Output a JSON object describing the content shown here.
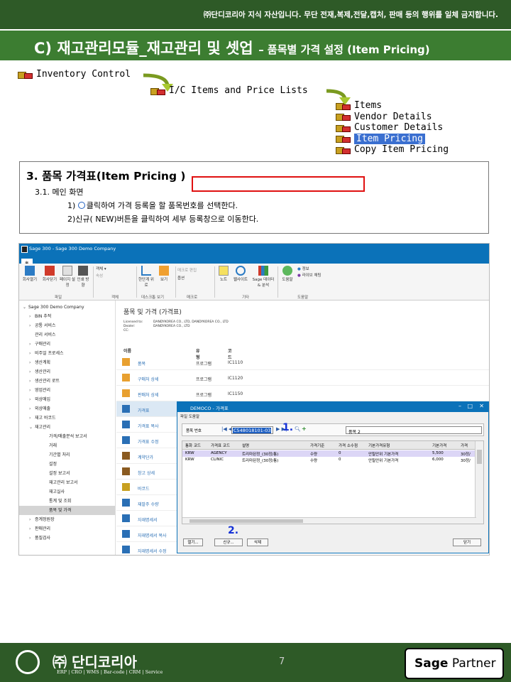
{
  "header": {
    "notice": "㈜단디코리아 지식 자산입니다. 무단 전재,복제,전달,캡처, 판매 등의 행위를 일체 금지합니다.",
    "title": "C) 재고관리모듈_재고관리 및 셋업",
    "subtitle": "– 품목별 가격 설정 (Item Pricing)"
  },
  "tree": {
    "root": "Inventory Control",
    "folder": "I/C Items and Price Lists",
    "items": [
      "Items",
      "Vendor Details",
      "Customer Details",
      "Item Pricing",
      "Copy Item Pricing"
    ],
    "selected": "Item Pricing"
  },
  "instructions": {
    "heading": "3. 품목 가격표(Item Pricing )",
    "sub": "3.1. 메인 화면",
    "step1": "클릭하여 가격 등록을 할 품목번호를 선택한다.",
    "step1_prefix": "1)",
    "step2": "2)신규( NEW)버튼을 클릭하여 세부 등록창으로 이동한다."
  },
  "sage": {
    "window_title": "Sage 300 - Sage 300 Demo Company",
    "menu_tab": "홈",
    "ribbon": {
      "buttons": [
        "회사열기",
        "회사닫기",
        "페이지 설정",
        "인쇄 방향",
        "객체",
        "속성",
        "한단계 위로",
        "보기",
        "매크로 편집",
        "옵션",
        "노트",
        "웹사이트",
        "Sage 데이터 & 분석",
        "도움말",
        "정보",
        "라이브 채팅"
      ],
      "groups": [
        "파일",
        "객체",
        "데스크톱 보기",
        "매크로",
        "기타",
        "도움말"
      ]
    },
    "nav": [
      {
        "label": "Sage 300 Demo Company",
        "level": 0,
        "chev": "⌄"
      },
      {
        "label": "BIN 추적",
        "level": 1,
        "chev": "›"
      },
      {
        "label": "공통 서비스",
        "level": 1,
        "chev": "›"
      },
      {
        "label": "관리 서비스",
        "level": 1,
        "chev": ""
      },
      {
        "label": "구매관리",
        "level": 1,
        "chev": "›"
      },
      {
        "label": "비주얼 프로세스",
        "level": 1,
        "chev": "›"
      },
      {
        "label": "생산계획",
        "level": 1,
        "chev": "›"
      },
      {
        "label": "생산관리",
        "level": 1,
        "chev": "›"
      },
      {
        "label": "생산관리 로트",
        "level": 1,
        "chev": "›"
      },
      {
        "label": "영업관리",
        "level": 1,
        "chev": "›"
      },
      {
        "label": "외상매입",
        "level": 1,
        "chev": "›"
      },
      {
        "label": "외상매출",
        "level": 1,
        "chev": "›"
      },
      {
        "label": "재고 바코드",
        "level": 1,
        "chev": "›"
      },
      {
        "label": "재고관리",
        "level": 1,
        "chev": "⌄"
      },
      {
        "label": "가격/매출분석 보고서",
        "level": 2,
        "chev": ""
      },
      {
        "label": "거래",
        "level": 2,
        "chev": ""
      },
      {
        "label": "기간별 처리",
        "level": 2,
        "chev": ""
      },
      {
        "label": "설정",
        "level": 2,
        "chev": ""
      },
      {
        "label": "설정 보고서",
        "level": 2,
        "chev": ""
      },
      {
        "label": "재고관리 보고서",
        "level": 2,
        "chev": ""
      },
      {
        "label": "재고실사",
        "level": 2,
        "chev": ""
      },
      {
        "label": "통계 및 조회",
        "level": 2,
        "chev": ""
      },
      {
        "label": "품목 및 가격",
        "level": 2,
        "chev": "",
        "selected": true
      },
      {
        "label": "증계정원장",
        "level": 1,
        "chev": "›"
      },
      {
        "label": "판매관리",
        "level": 1,
        "chev": "›"
      },
      {
        "label": "품질검사",
        "level": 1,
        "chev": "›"
      }
    ],
    "content_title": "품목 및 가격 (가격표)",
    "license": {
      "licensed_label": "Licensed to:",
      "licensed_value": "DANDYKOREA CO., LTD, DANDYKOREA CO., LTD",
      "dealer_label": "Dealer:",
      "dealer_value": "DANDYKOREA CO., LTD",
      "cc_label": "CC:"
    },
    "columns": {
      "name": "이름",
      "type": "유형",
      "code": "코드"
    },
    "programs": [
      {
        "name": "품목",
        "type": "프로그램",
        "code": "IC1110"
      },
      {
        "name": "구매처 상세",
        "type": "프로그램",
        "code": "IC1120"
      },
      {
        "name": "판매처 상세",
        "type": "프로그램",
        "code": "IC1150"
      },
      {
        "name": "가격표",
        "type": "",
        "code": "",
        "selected": true
      },
      {
        "name": "가격표 복사",
        "type": "",
        "code": ""
      },
      {
        "name": "가격표 수정",
        "type": "",
        "code": ""
      },
      {
        "name": "계약단가",
        "type": "",
        "code": ""
      },
      {
        "name": "창고 상세",
        "type": "",
        "code": ""
      },
      {
        "name": "바코드",
        "type": "",
        "code": ""
      },
      {
        "name": "재발주 수량",
        "type": "",
        "code": ""
      },
      {
        "name": "자재명세서",
        "type": "",
        "code": ""
      },
      {
        "name": "자재명세서 복사",
        "type": "",
        "code": ""
      },
      {
        "name": "자재명세서 수정",
        "type": "",
        "code": ""
      }
    ]
  },
  "dialog": {
    "title": "DEMOCO - 가격표",
    "menu": "파일  도움말",
    "item_label": "품목 번호",
    "item_no": "C548018101-03",
    "item_desc": "품목 2",
    "columns": [
      "통화 코드",
      "가격표 코드",
      "설명",
      "가격기준",
      "가격 소수점",
      "기본가격유형",
      "기본가격",
      "가격"
    ],
    "rows": [
      [
        "KRW",
        "AGENCY",
        "트리마된정_(30정/통)",
        "수량",
        "0",
        "안될안위 기본가격",
        "5,500",
        "30정/"
      ],
      [
        "KRW",
        "CLINIC",
        "트리마된정_(30정/통)",
        "수량",
        "0",
        "안될안위 기본가격",
        "6,000",
        "30정/"
      ]
    ],
    "buttons": {
      "open": "열기...",
      "new": "신규...",
      "delete": "삭제",
      "close": "닫기"
    },
    "callout1": "1.",
    "callout2": "2."
  },
  "footer": {
    "company": "㈜ 단디코리아",
    "tagline": "ERP | CRO | WMS | Bar-code | CRM | Service",
    "page": "7",
    "partner_brand": "Sage",
    "partner_label": "Partner"
  },
  "colors": {
    "green_dark": "#2e5a27",
    "green": "#3c7d31",
    "sage_blue": "#0b72b9",
    "callout_red": "#e01010",
    "callout_blue": "#1431d6"
  }
}
